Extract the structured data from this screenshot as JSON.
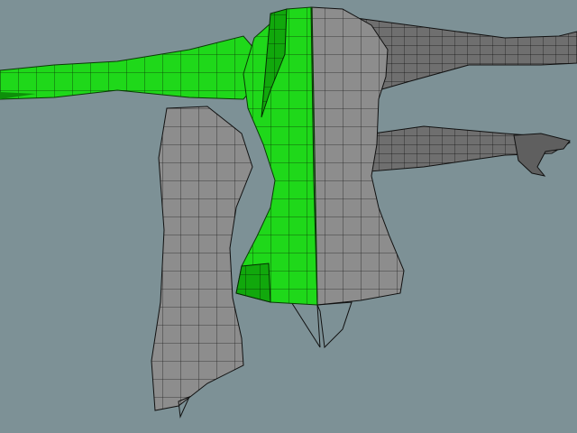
{
  "viewport": {
    "background": "#7d9196",
    "selection_color": "#22dd11",
    "mesh_color": "#8e8e8e",
    "wire_color": "#111111"
  },
  "model": {
    "parts": [
      "torso",
      "left-arm-raised",
      "right-arm-raised",
      "right-arm-lower",
      "left-arm-lower",
      "hand-right"
    ],
    "selected_region": "left-half-torso-and-arm"
  }
}
